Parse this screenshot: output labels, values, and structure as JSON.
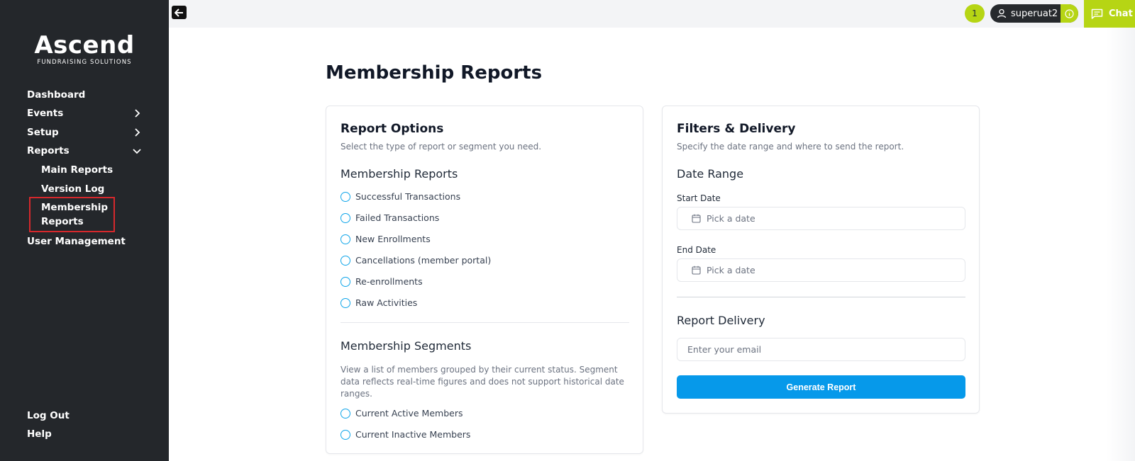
{
  "brand": {
    "name": "Ascend",
    "tagline": "FUNDRAISING SOLUTIONS"
  },
  "sidebar": {
    "items": [
      {
        "label": "Dashboard"
      },
      {
        "label": "Events"
      },
      {
        "label": "Setup"
      },
      {
        "label": "Reports"
      }
    ],
    "reports_sub": [
      {
        "label": "Main Reports"
      },
      {
        "label": "Version Log"
      },
      {
        "label": "Membership Reports"
      }
    ],
    "user_management": "User Management",
    "logout": "Log Out",
    "help": "Help"
  },
  "topbar": {
    "notification_count": "1",
    "username": "superuat2",
    "chat_label": "Chat"
  },
  "page": {
    "title": "Membership Reports"
  },
  "report_options": {
    "title": "Report Options",
    "description": "Select the type of report or segment you need.",
    "membership_reports_title": "Membership Reports",
    "membership_reports": [
      "Successful Transactions",
      "Failed Transactions",
      "New Enrollments",
      "Cancellations (member portal)",
      "Re-enrollments",
      "Raw Activities"
    ],
    "segments_title": "Membership Segments",
    "segments_description": "View a list of members grouped by their current status. Segment data reflects real-time figures and does not support historical date ranges.",
    "segments": [
      "Current Active Members",
      "Current Inactive Members"
    ]
  },
  "filters": {
    "title": "Filters & Delivery",
    "description": "Specify the date range and where to send the report.",
    "date_range_title": "Date Range",
    "start_label": "Start Date",
    "start_placeholder": "Pick a date",
    "end_label": "End Date",
    "end_placeholder": "Pick a date",
    "delivery_title": "Report Delivery",
    "email_placeholder": "Enter your email",
    "generate_label": "Generate Report"
  },
  "colors": {
    "sidebar_bg": "#24272b",
    "accent_lime": "#b6d514",
    "primary_blue": "#0699ea",
    "highlight_red": "#d6282c"
  }
}
